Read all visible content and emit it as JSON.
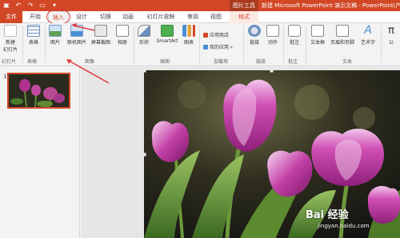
{
  "titlebar": {
    "context_tab": "图片工具",
    "window_title": "新建 Microsoft PowerPoint 演示文稿 - PowerPoint(产",
    "qat_icons": [
      "save-icon",
      "undo-icon",
      "redo-icon",
      "start-presentation-icon",
      "customize-icon"
    ]
  },
  "tabs": {
    "file": "文件",
    "home": "开始",
    "insert": "插入",
    "design": "设计",
    "transitions": "切换",
    "animations": "动画",
    "slideshow": "幻灯片放映",
    "review": "审阅",
    "view": "视图",
    "format": "格式"
  },
  "ribbon": {
    "slides": {
      "new_slide": "新建",
      "new_slide2": "幻灯片",
      "group": "幻灯片"
    },
    "tables": {
      "table": "表格",
      "group": "表格"
    },
    "images": {
      "picture": "图片",
      "online_picture": "联机图片",
      "screenshot": "屏幕截图",
      "album": "相册",
      "group": "图像"
    },
    "illustrations": {
      "shapes": "形状",
      "smartart": "SmartArt",
      "chart": "图表",
      "group": "插图"
    },
    "addins": {
      "store": "应用商店",
      "my_apps": "我的应用",
      "group": "加载项"
    },
    "links": {
      "link": "链接",
      "action": "动作",
      "group": "链接"
    },
    "comments": {
      "comment": "批注",
      "group": "批注"
    },
    "text": {
      "textbox": "文本框",
      "header_footer": "页眉和页脚",
      "wordart": "艺术字",
      "group": "文本"
    },
    "symbols": {
      "formula": "公"
    }
  },
  "slides_panel": {
    "slide_number": "1"
  },
  "watermark": {
    "brand": "Bai 经验",
    "url": "jingyan.baidu.com"
  },
  "colors": {
    "accent": "#d24726",
    "annotation": "#e03b3b"
  }
}
